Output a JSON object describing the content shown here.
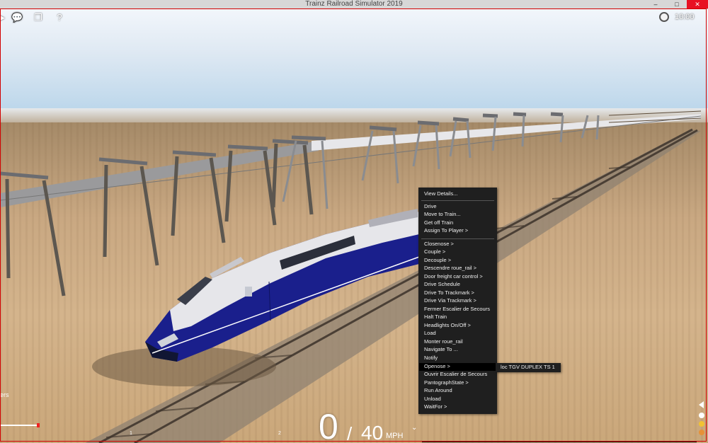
{
  "window": {
    "title": "Trainz Railroad Simulator 2019",
    "controls": {
      "minimize": "–",
      "maximize": "□",
      "close": "✕"
    }
  },
  "hud": {
    "icons": [
      "chat-icon",
      "windows-icon",
      "help-icon"
    ],
    "clock_time": "10:00"
  },
  "context_menu": {
    "items": [
      "View Details...",
      "Drive",
      "Move to Train...",
      "Get off Train",
      "Assign To Player >",
      "Closenose >",
      "Couple >",
      "Decouple >",
      "Descendre roue_rail >",
      "Door freight car control >",
      "Drive Schedule",
      "Drive To Trackmark >",
      "Drive Via Trackmark >",
      "Fermer Escalier de Secours",
      "Halt Train",
      "Headlights On/Off >",
      "Load",
      "Monter roue_rail",
      "Navigate To ...",
      "Notify",
      "Openose >",
      "Ouvrir Escalier de Secours",
      "PantographState >",
      "Run Around",
      "Unload",
      "WaitFor >"
    ],
    "highlighted": "Openose >"
  },
  "submenu": {
    "item": "loc TGV DUPLEX TS 1"
  },
  "speedometer": {
    "speed": "0",
    "separator": "/",
    "limit": "40",
    "unit": "MPH"
  },
  "left_hud": {
    "text": "ers"
  },
  "track_markers": [
    "1",
    "2"
  ],
  "colors": {
    "train_blue": "#1a1f8c",
    "menu_bg": "#1f1f1f",
    "accent_red": "#e81123"
  }
}
